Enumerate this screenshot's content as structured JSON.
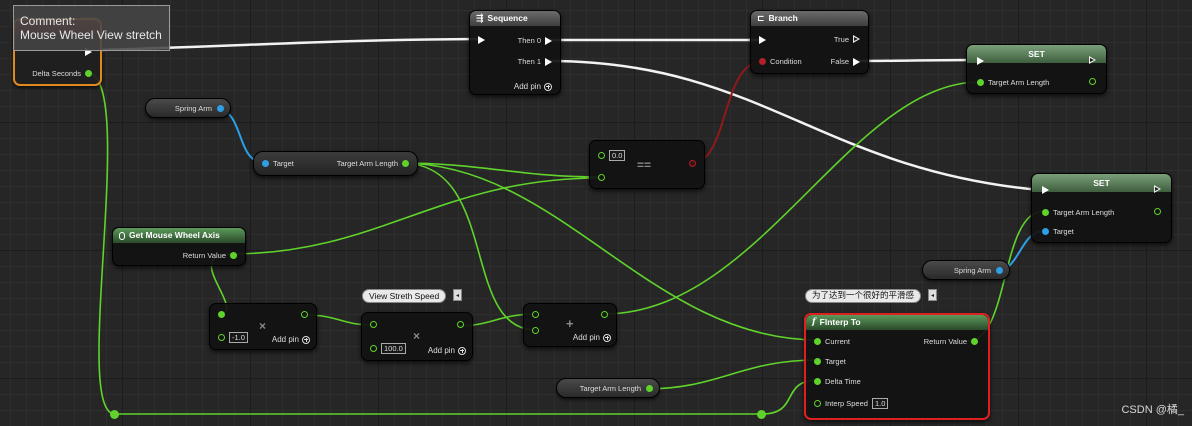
{
  "comment": {
    "label": "Comment:",
    "text": "Mouse Wheel View stretch"
  },
  "event_node": {
    "delta_seconds": "Delta Seconds"
  },
  "sequence": {
    "title": "Sequence",
    "then0": "Then 0",
    "then1": "Then 1",
    "add_pin": "Add pin"
  },
  "branch": {
    "title": "Branch",
    "condition": "Condition",
    "true": "True",
    "false": "False"
  },
  "set_top": {
    "title": "SET",
    "target_arm_length": "Target Arm Length"
  },
  "set_right": {
    "title": "SET",
    "target_arm_length": "Target Arm Length",
    "target": "Target"
  },
  "spring_arm_var_1": "Spring Arm",
  "spring_arm_var_2": "Spring Arm",
  "get_arm_length": {
    "target": "Target",
    "target_arm_length": "Target Arm Length"
  },
  "equals_node": {
    "default": "0.0",
    "symbol": "=="
  },
  "mouse_wheel": {
    "title": "Get Mouse Wheel Axis",
    "return_value": "Return Value"
  },
  "multiply_1": {
    "default": "-1.0",
    "symbol": "×",
    "add_pin": "Add pin"
  },
  "multiply_2": {
    "default": "100.0",
    "symbol": "×",
    "add_pin": "Add pin"
  },
  "add_node": {
    "symbol": "+",
    "add_pin": "Add pin"
  },
  "view_speed_comment": "View Streth Speed",
  "finterp_comment": "为了达到一个很好的平滑感",
  "finterp": {
    "title": "FInterp To",
    "current": "Current",
    "target": "Target",
    "delta_time": "Delta Time",
    "interp_speed": "Interp Speed",
    "interp_speed_value": "1.0",
    "return_value": "Return Value"
  },
  "target_arm_length_var": "Target Arm Length",
  "watermark": "CSDN @橘_",
  "colors": {
    "exec": "#ffffff",
    "float": "#5fd32b",
    "object": "#2f9fe5",
    "bool": "#b0202a",
    "selected": "#e02020",
    "event_outline": "#e08a1e"
  }
}
